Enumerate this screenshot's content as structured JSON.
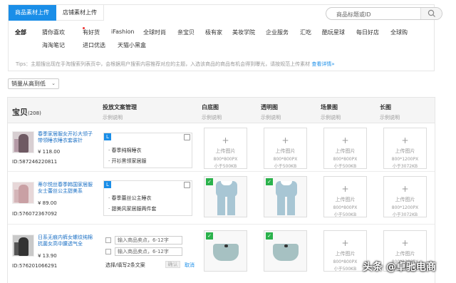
{
  "tabs": [
    {
      "label": "商品素材上传",
      "active": true
    },
    {
      "label": "店铺素材上传",
      "active": false
    }
  ],
  "search": {
    "placeholder": "商品标题或ID"
  },
  "categories": [
    "全部",
    "猜你喜欢",
    "有好货",
    "iFashion",
    "全球时尚",
    "亲宝贝",
    "极有家",
    "美妆学院",
    "企业服务",
    "汇吃",
    "酷玩星球",
    "每日好店",
    "全球购",
    "海淘笔记",
    "进口优选",
    "天猫小黑盒"
  ],
  "tips": {
    "text": "Tips：主题搜出现在手淘搜索列表页中，会根据用户搜索内容推荐对应的主题，入选该商品的商品有机会得到曝光，请按规范上传素材",
    "link": "查看详情»"
  },
  "sort": {
    "label": "销量从高到低",
    "chevron": "chevron-down-icon"
  },
  "table": {
    "headers": [
      {
        "title": "宝贝",
        "count": "(208)"
      },
      {
        "title": "投放文案管理",
        "sub": "示例说明"
      },
      {
        "title": "白底图",
        "sub": "示例说明"
      },
      {
        "title": "透明图",
        "sub": "示例说明"
      },
      {
        "title": "场景图",
        "sub": "示例说明"
      },
      {
        "title": "长图",
        "sub": "示例说明"
      }
    ],
    "upload": {
      "plus": "+",
      "label": "上传图片",
      "size_std": "800*800PX",
      "limit_std": "小于500KB",
      "size_long": "800*1200PX",
      "limit_long": "小于3072KB",
      "check": "✓"
    },
    "rows": [
      {
        "title": "春季家居服女开衫大领子带领睡衣睡衣套装针",
        "price": "¥ 118.00",
        "id": "ID:587246220811",
        "copy_tag": "L",
        "copy_lines": [
          "· 春季纯棉睡衣",
          "· 开衫黑领家居服"
        ]
      },
      {
        "title": "蒂尔悦丝春季韩国家居服女士蕾丝公主甜美系",
        "price": "¥ 89.00",
        "id": "ID:576072367092",
        "copy_tag": "L",
        "copy_lines": [
          "· 春季蕾丝公主睡衣",
          "· 甜美风家居服两件套"
        ]
      },
      {
        "title": "日系无痕内裤女螺纹纯棉抗菌女高中腰透气全",
        "price": "¥ 13.90",
        "id": "ID:576201066291",
        "input_placeholder": "输入商品卖点，6-12字",
        "select_info": "选择/填写2条文案",
        "ok_label": "确认",
        "cancel_label": "取消"
      }
    ]
  },
  "watermark": "头条 @卓驰电商",
  "colors": {
    "accent": "#1a8ee8",
    "check": "#2bb24c",
    "dot": "#ee3333"
  }
}
